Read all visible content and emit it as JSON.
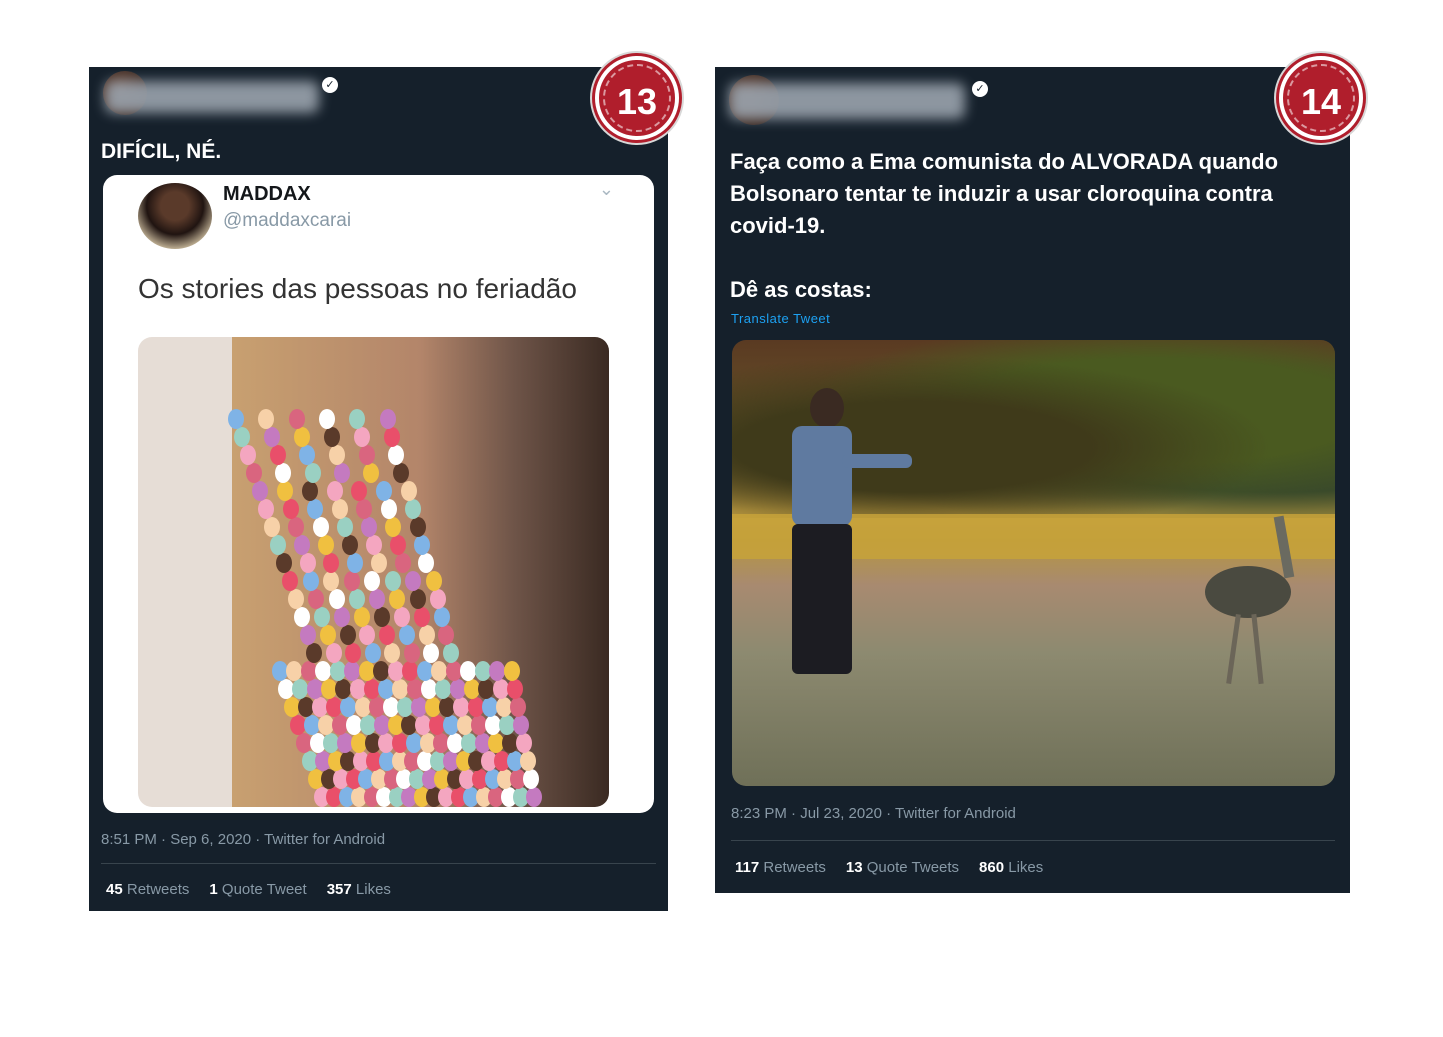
{
  "tweet13": {
    "badge_number": "13",
    "verified_glyph": "✓",
    "text": "DIFÍCIL, NÉ.",
    "quoted": {
      "name": "MADDAX",
      "handle": "@maddaxcarai",
      "chevron": "⌄",
      "text": "Os stories das pessoas no feriadão"
    },
    "meta": "8:51 PM · Sep 6, 2020 · Twitter for Android",
    "stats": {
      "retweets_count": "45",
      "retweets_label": "Retweets",
      "quotes_count": "1",
      "quotes_label": "Quote Tweet",
      "likes_count": "357",
      "likes_label": "Likes"
    }
  },
  "tweet14": {
    "badge_number": "14",
    "verified_glyph": "✓",
    "text_line1": "Faça como a Ema comunista do ALVORADA quando",
    "text_line2": "Bolsonaro tentar te induzir a usar cloroquina contra",
    "text_line3": "covid-19.",
    "text_line4": "Dê as costas:",
    "translate": "Translate Tweet",
    "meta": "8:23 PM · Jul 23, 2020 · Twitter for Android",
    "stats": {
      "retweets_count": "117",
      "retweets_label": "Retweets",
      "quotes_count": "13",
      "quotes_label": "Quote Tweets",
      "likes_count": "860",
      "likes_label": "Likes"
    }
  },
  "colors": {
    "tweet_bg": "#15202b",
    "badge_red": "#b01e2c",
    "link_blue": "#1da1f2",
    "muted": "#8899a6"
  },
  "icons": [
    "verified-badge-icon",
    "chevron-down-icon"
  ]
}
